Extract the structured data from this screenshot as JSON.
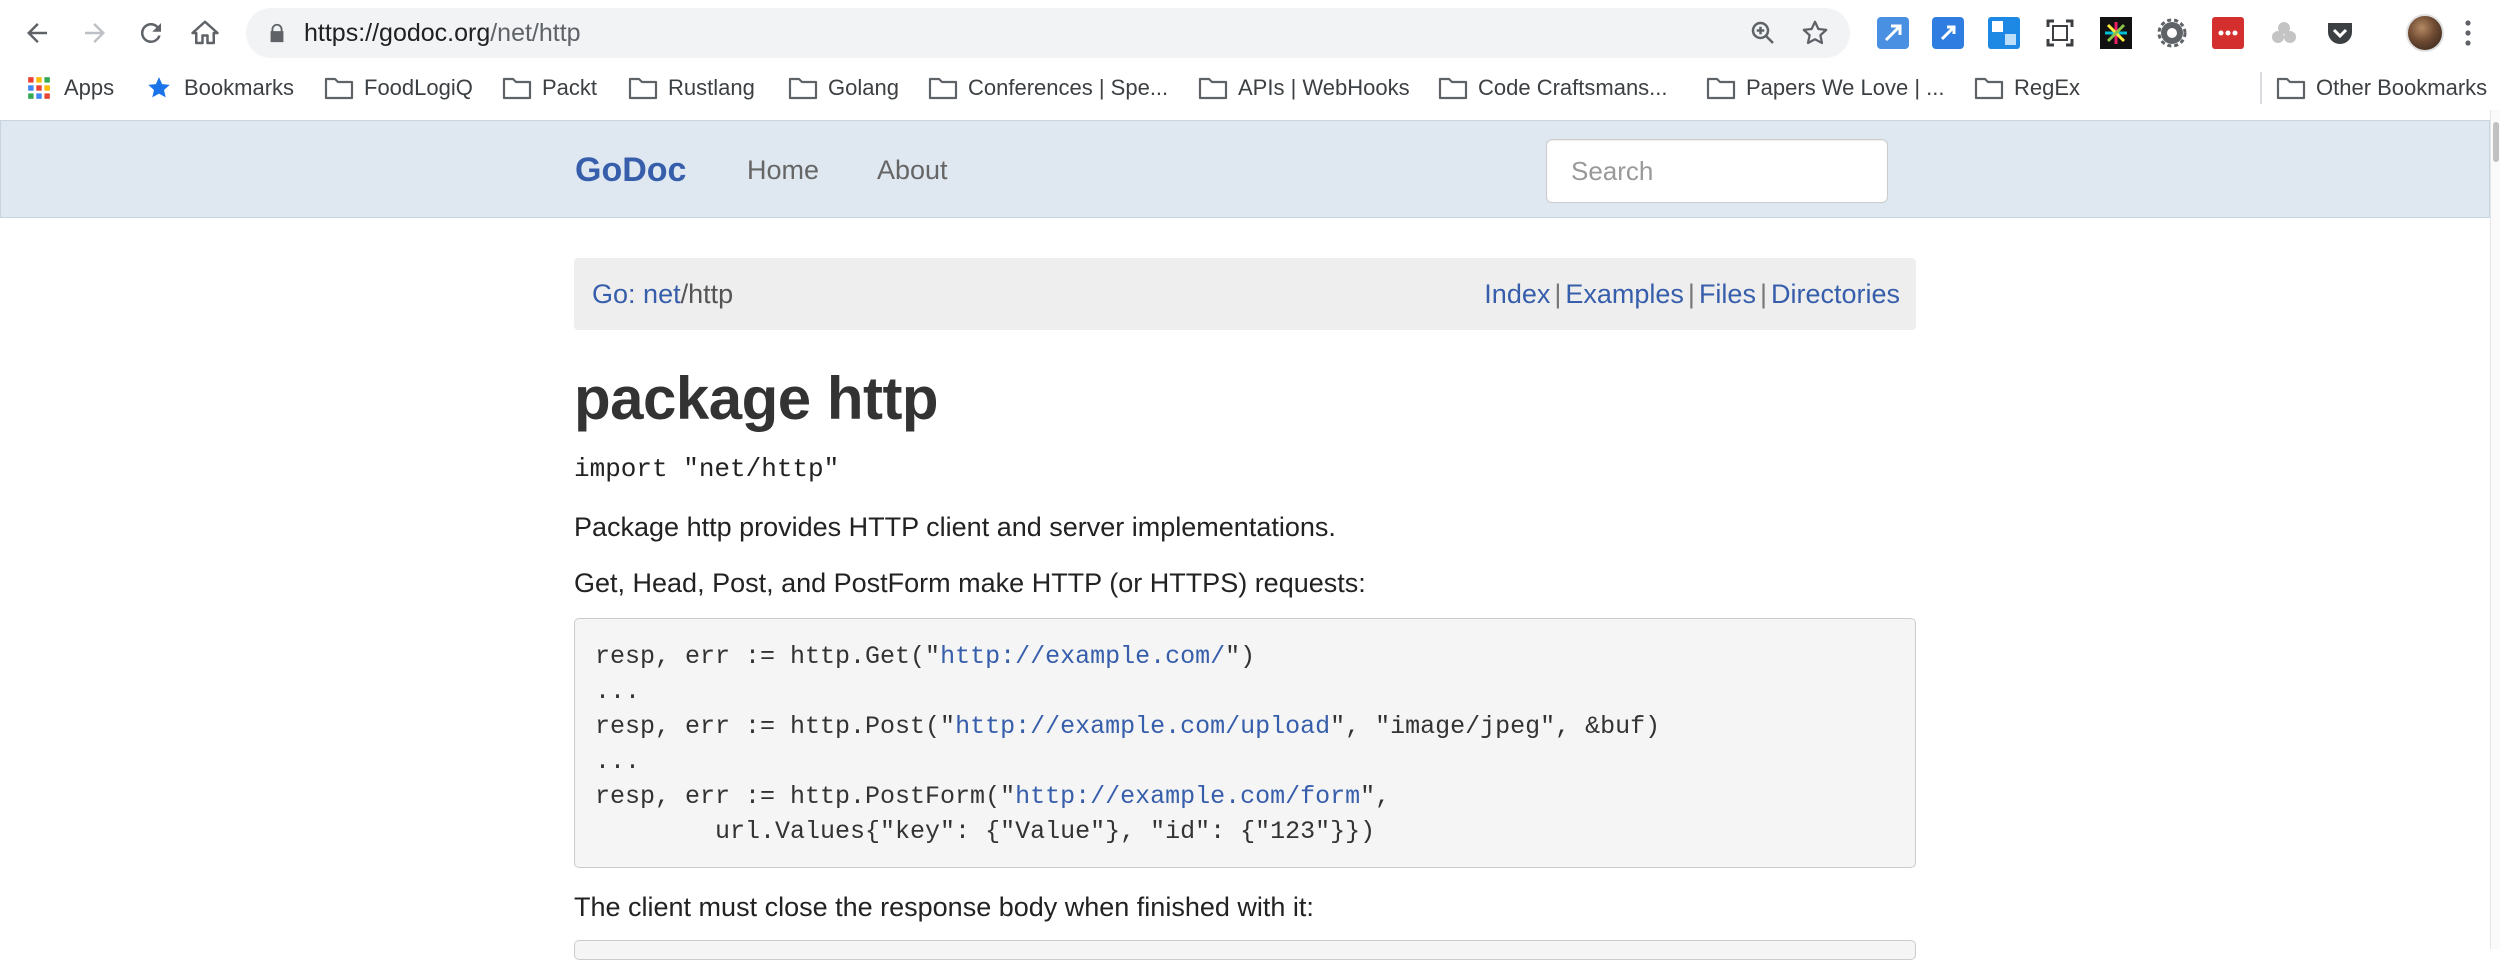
{
  "browser": {
    "url_host": "https://godoc.org",
    "url_path": "/net/http",
    "bookmarks": [
      {
        "label": "Apps",
        "icon": "apps-grid-icon"
      },
      {
        "label": "Bookmarks",
        "icon": "star-icon"
      },
      {
        "label": "FoodLogiQ",
        "icon": "folder-icon"
      },
      {
        "label": "Packt",
        "icon": "folder-icon"
      },
      {
        "label": "Rustlang",
        "icon": "folder-icon"
      },
      {
        "label": "Golang",
        "icon": "folder-icon"
      },
      {
        "label": "Conferences | Spe...",
        "icon": "folder-icon"
      },
      {
        "label": "APIs | WebHooks",
        "icon": "folder-icon"
      },
      {
        "label": "Code Craftsmans...",
        "icon": "folder-icon"
      },
      {
        "label": "Papers We Love | ...",
        "icon": "folder-icon"
      },
      {
        "label": "RegEx",
        "icon": "folder-icon"
      },
      {
        "label": "Other Bookmarks",
        "icon": "folder-icon"
      }
    ]
  },
  "navbar": {
    "brand": "GoDoc",
    "links": [
      "Home",
      "About"
    ],
    "search_placeholder": "Search"
  },
  "breadcrumb": {
    "root": "Go:",
    "seg1": "net",
    "sep": "/",
    "current": "http"
  },
  "toc": [
    "Index",
    "Examples",
    "Files",
    "Directories"
  ],
  "toc_separator": "|",
  "page": {
    "title": "package http",
    "import_line": "import \"net/http\"",
    "intro": "Package http provides HTTP client and server implementations.",
    "requests_text": "Get, Head, Post, and PostForm make HTTP (or HTTPS) requests:",
    "close_text": "The client must close the response body when finished with it:"
  },
  "code": {
    "l1_pre": "resp, err := http.Get(\"",
    "l1_link": "http://example.com/",
    "l1_post": "\")",
    "l2": "...",
    "l3_pre": "resp, err := http.Post(\"",
    "l3_link": "http://example.com/upload",
    "l3_post": "\", \"image/jpeg\", &buf)",
    "l4": "...",
    "l5_pre": "resp, err := http.PostForm(\"",
    "l5_link": "http://example.com/form",
    "l5_post": "\",",
    "l6": "        url.Values{\"key\": {\"Value\"}, \"id\": {\"123\"}})"
  },
  "colors": {
    "link": "#375eab",
    "navbar_bg": "#dfe8f1",
    "well_bg": "#eeeeee",
    "code_bg": "#f5f5f5"
  }
}
